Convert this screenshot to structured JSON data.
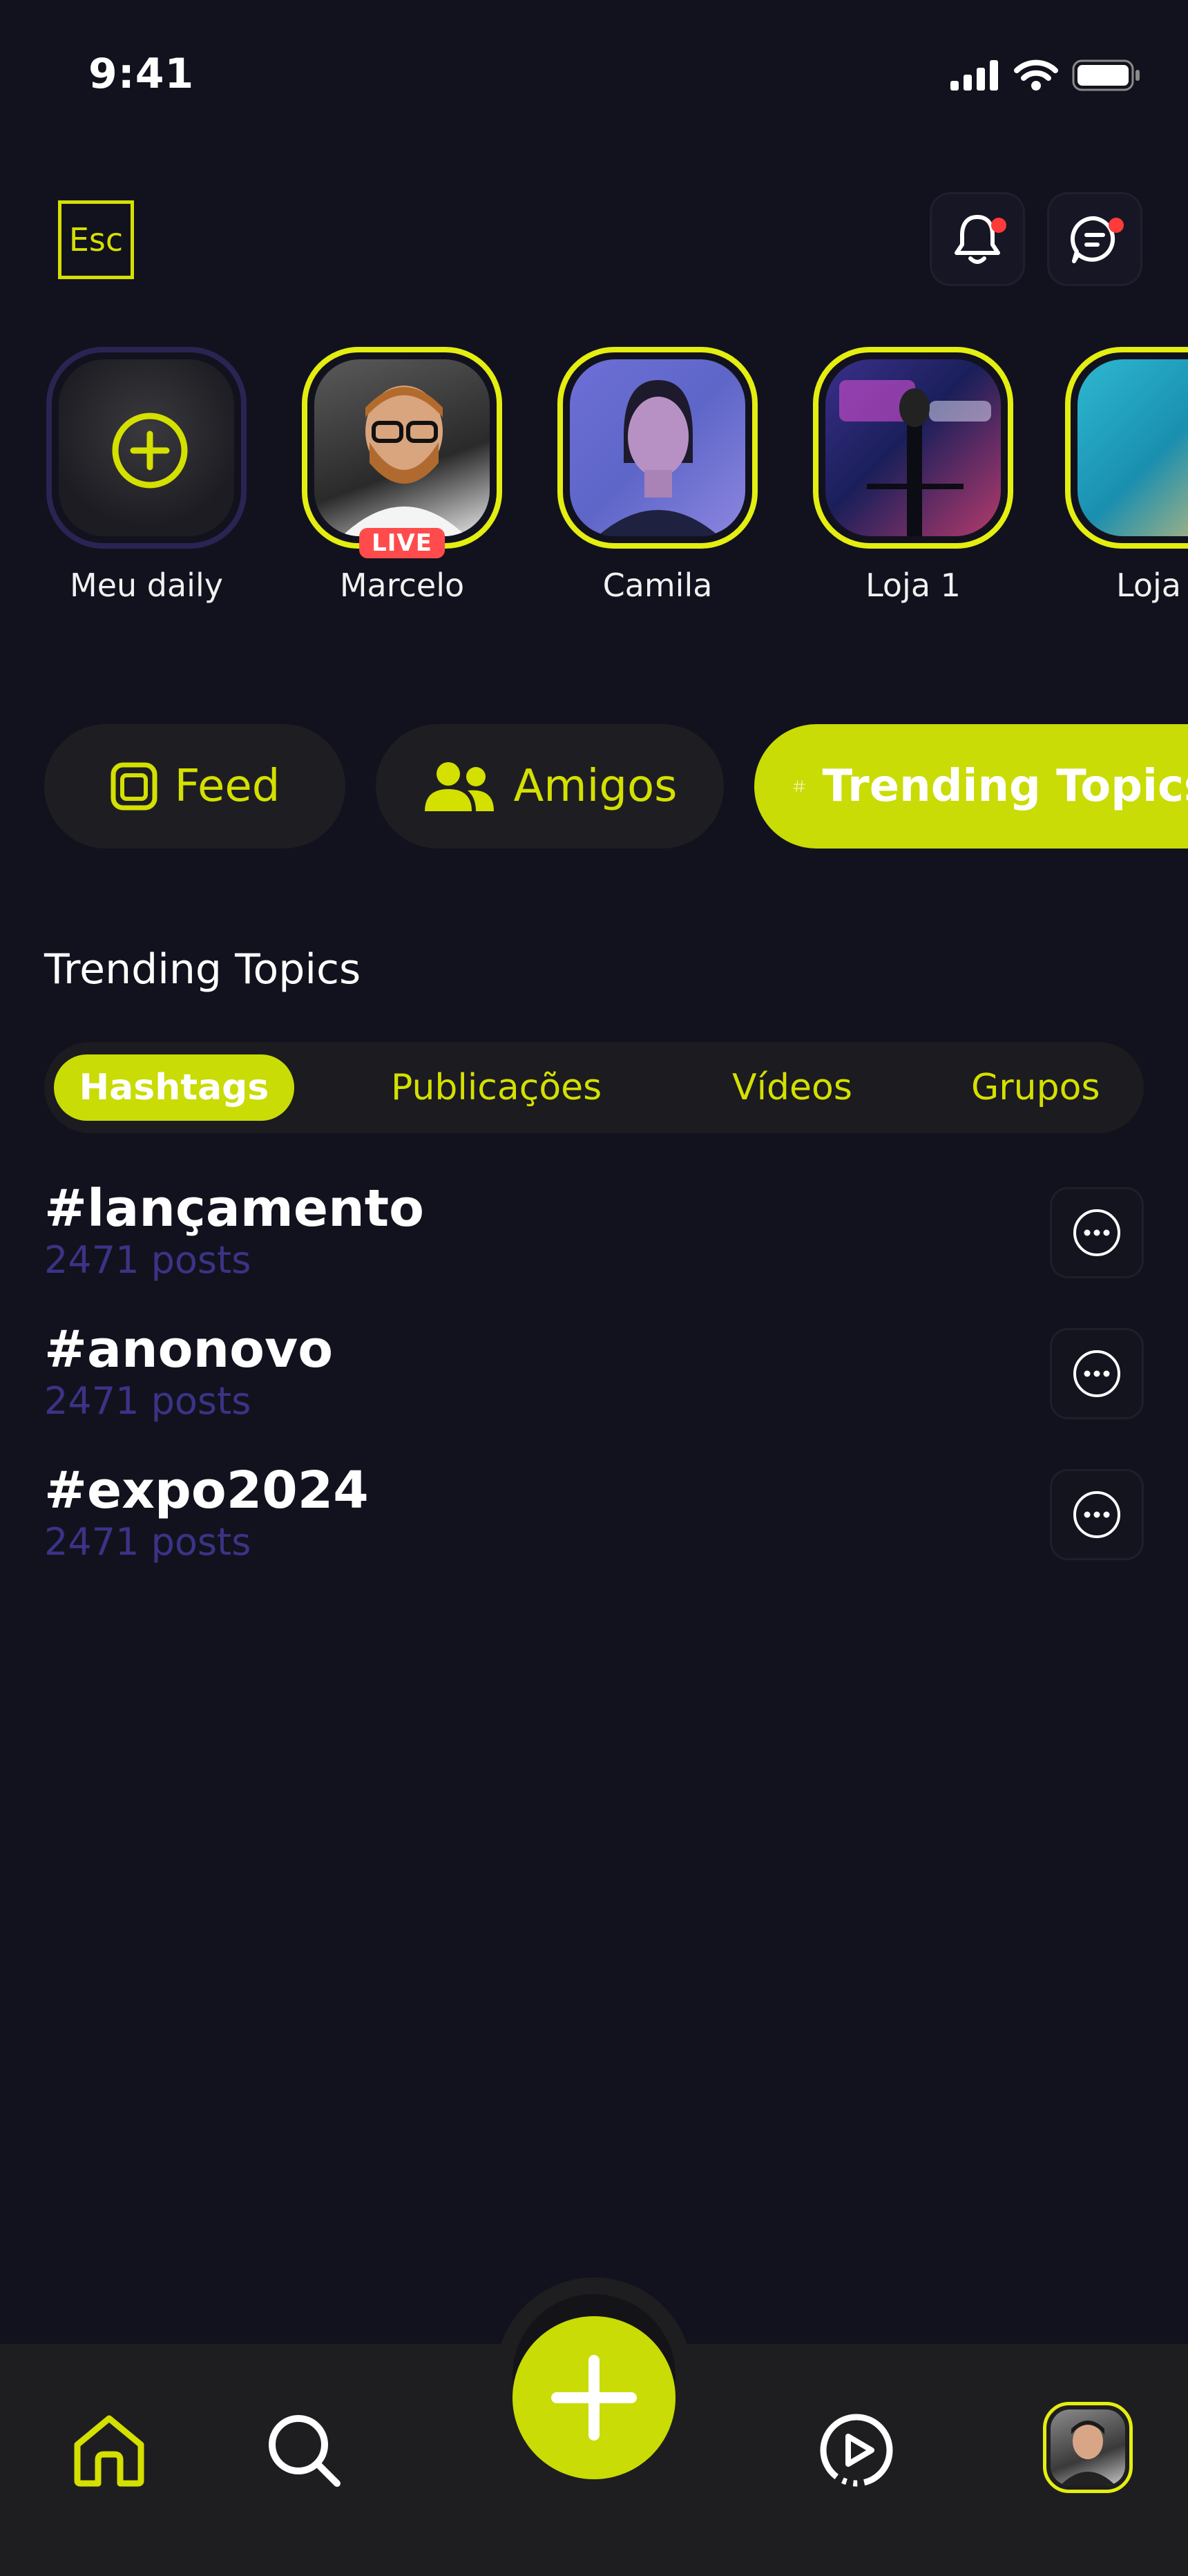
{
  "status_bar": {
    "time": "9:41"
  },
  "header": {
    "logo_text": "Esc"
  },
  "stories": [
    {
      "name": "Meu daily",
      "own": true,
      "live": false
    },
    {
      "name": "Marcelo",
      "own": false,
      "live": true
    },
    {
      "name": "Camila",
      "own": false,
      "live": false
    },
    {
      "name": "Loja 1",
      "own": false,
      "live": false
    },
    {
      "name": "Loja",
      "own": false,
      "live": false
    }
  ],
  "live_label": "LIVE",
  "main_tabs": [
    {
      "label": "Feed",
      "icon": "feed-icon"
    },
    {
      "label": "Amigos",
      "icon": "users-icon"
    },
    {
      "label": "Trending Topics",
      "icon": "hashtag-icon",
      "active": true
    }
  ],
  "section_title": "Trending Topics",
  "segments": [
    {
      "label": "Hashtags",
      "active": true
    },
    {
      "label": "Publicações"
    },
    {
      "label": "Vídeos"
    },
    {
      "label": "Grupos"
    }
  ],
  "topics": [
    {
      "tag": "#lançamento",
      "count": "2471 posts"
    },
    {
      "tag": "#anonovo",
      "count": "2471 posts"
    },
    {
      "tag": "#expo2024",
      "count": "2471 posts"
    }
  ],
  "bottom_nav": [
    {
      "icon": "home-icon",
      "active": true
    },
    {
      "icon": "search-icon"
    },
    {
      "icon": "plus-icon"
    },
    {
      "icon": "play-icon"
    },
    {
      "icon": "profile-avatar"
    }
  ],
  "colors": {
    "accent": "#c9dc05",
    "background": "#12121e",
    "live": "#ff4b4b",
    "muted_count": "#3b3386"
  }
}
